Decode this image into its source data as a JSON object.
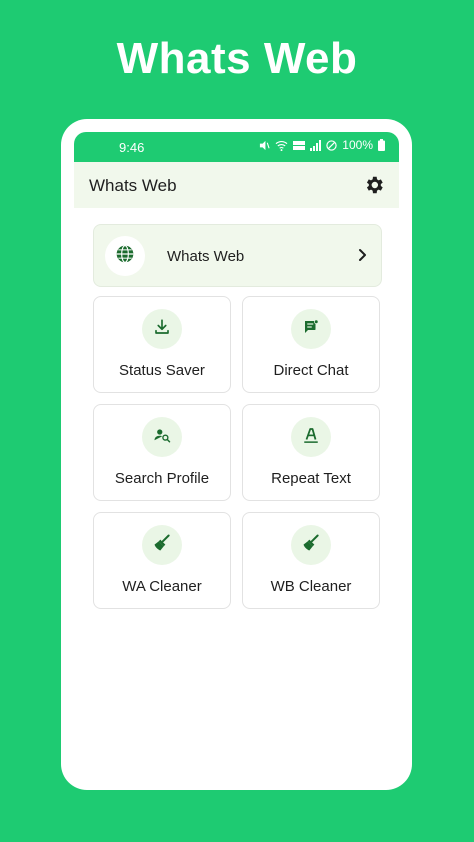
{
  "promo": {
    "title": "Whats Web"
  },
  "status_bar": {
    "time": "9:46",
    "battery": "100%"
  },
  "app_bar": {
    "title": "Whats Web",
    "settings_icon": "gear-icon"
  },
  "main_card": {
    "label": "Whats Web",
    "icon": "globe-icon"
  },
  "tiles": [
    {
      "label": "Status Saver",
      "icon": "download-icon"
    },
    {
      "label": "Direct Chat",
      "icon": "chat-icon"
    },
    {
      "label": "Search Profile",
      "icon": "search-profile-icon"
    },
    {
      "label": "Repeat Text",
      "icon": "text-format-icon"
    },
    {
      "label": "WA Cleaner",
      "icon": "broom-icon"
    },
    {
      "label": "WB Cleaner",
      "icon": "broom-icon"
    }
  ],
  "colors": {
    "background": "#1ecb72",
    "accent": "#1b6b2e",
    "card_tint": "#f1f8ec",
    "icon_circle": "#eaf6e6"
  }
}
